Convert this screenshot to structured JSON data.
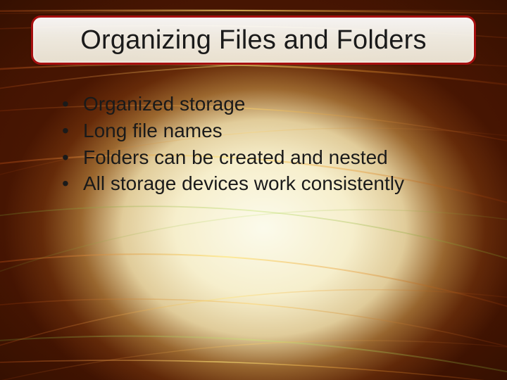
{
  "title": "Organizing Files and Folders",
  "bullets": [
    "Organized storage",
    "Long file names",
    "Folders can be created and nested",
    "All storage devices work consistently"
  ]
}
